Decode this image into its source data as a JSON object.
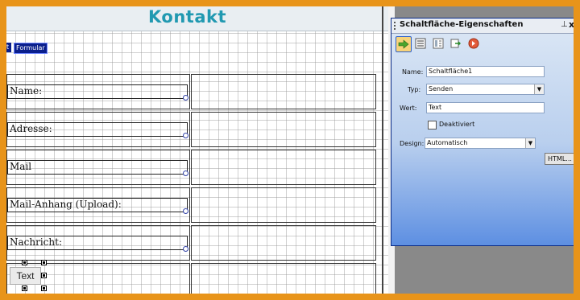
{
  "canvas": {
    "heading": "Kontakt",
    "form_tag_left": "t",
    "form_tag": "Formular",
    "fields": [
      "Name:",
      "Adresse:",
      "Mail",
      "Mail-Anhang (Upload):",
      "Nachricht:"
    ],
    "text_button": "Text"
  },
  "panel": {
    "title": "Schaltfläche-Eigenschaften",
    "pin": "⊥",
    "close": "x",
    "toolbar_icons": [
      "arrow-right-icon",
      "list-icon",
      "layout-icon",
      "export-icon",
      "stop-icon"
    ],
    "name_label": "Name:",
    "name_value": "Schaltfläche1",
    "type_label": "Typ:",
    "type_value": "Senden",
    "value_label": "Wert:",
    "value_value": "Text",
    "disabled_label": "Deaktiviert",
    "design_label": "Design:",
    "design_value": "Automatisch",
    "html_button": "HTML..."
  },
  "colors": {
    "heading": "#2199b1",
    "frame": "#e8941a",
    "panel_border": "#0b2b86",
    "tag_bg": "#0a1f8c"
  }
}
